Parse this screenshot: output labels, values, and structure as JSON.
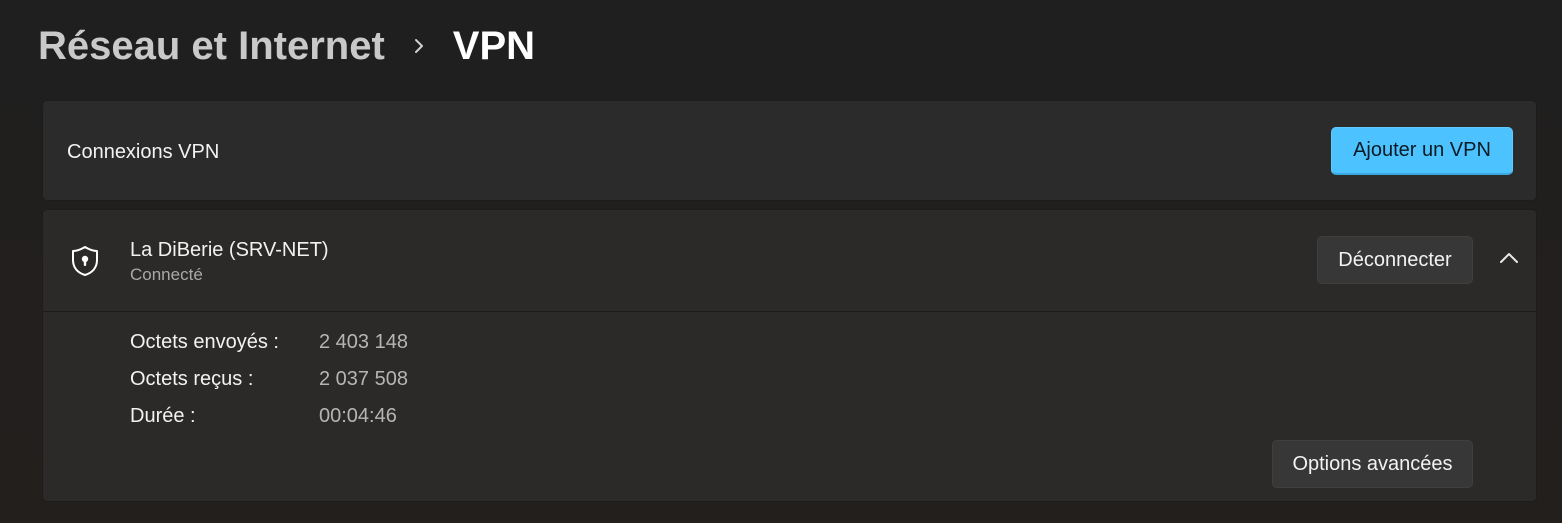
{
  "breadcrumb": {
    "parent": "Réseau et Internet",
    "current": "VPN",
    "separator_icon": "chevron-right-icon"
  },
  "connections_card": {
    "label": "Connexions VPN",
    "add_button_label": "Ajouter un VPN",
    "accent_color": "#4cc2ff"
  },
  "vpn_connection": {
    "icon": "shield-lock-icon",
    "name": "La DiBerie (SRV-NET)",
    "status": "Connecté",
    "disconnect_label": "Déconnecter",
    "expand_icon": "chevron-up-icon",
    "stats": [
      {
        "label": "Octets envoyés :",
        "value": "2 403 148"
      },
      {
        "label": "Octets reçus :",
        "value": "2 037 508"
      },
      {
        "label": "Durée :",
        "value": "00:04:46"
      }
    ],
    "advanced_options_label": "Options avancées"
  }
}
